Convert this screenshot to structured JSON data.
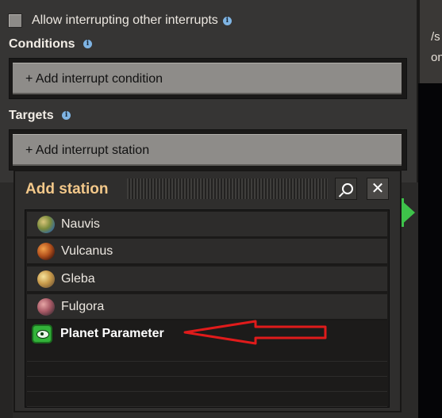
{
  "panel": {
    "allow_interrupting_label": "Allow interrupting other interrupts",
    "conditions_title": "Conditions",
    "add_condition_label": "+ Add interrupt condition",
    "targets_title": "Targets",
    "add_station_label": "+ Add interrupt station"
  },
  "background": {
    "right_text_1": "/s",
    "right_text_2": "on"
  },
  "popup": {
    "title": "Add station",
    "close_symbol": "✕",
    "items": [
      {
        "label": "Nauvis",
        "icon": "planet-nauvis-icon"
      },
      {
        "label": "Vulcanus",
        "icon": "planet-vulcanus-icon"
      },
      {
        "label": "Gleba",
        "icon": "planet-gleba-icon"
      },
      {
        "label": "Fulgora",
        "icon": "planet-fulgora-icon"
      }
    ],
    "parameter_item": {
      "label": "Planet Parameter",
      "icon": "planet-parameter-icon"
    }
  },
  "colors": {
    "popup_title": "#f3c88a",
    "annotation_arrow": "#e01b1b",
    "parameter_icon": "#33b33a",
    "info_icon": "#7fb4e3"
  }
}
